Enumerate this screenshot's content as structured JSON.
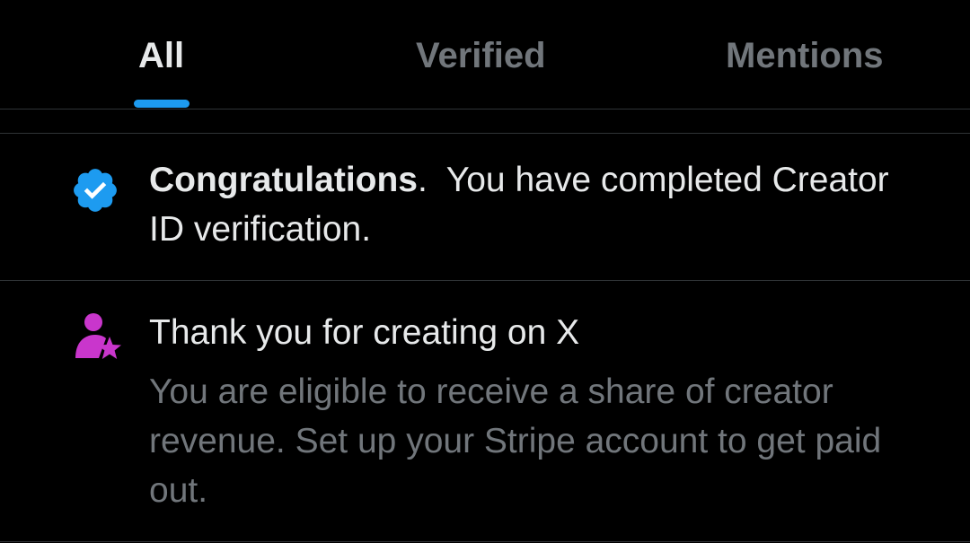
{
  "theme": {
    "background": "#000000",
    "text_primary": "#e7e9ea",
    "text_secondary": "#71767b",
    "divider": "#2f3336",
    "accent_blue": "#1d9bf0",
    "accent_purple": "#c936cc"
  },
  "tabs": [
    {
      "label": "All",
      "active": true
    },
    {
      "label": "Verified",
      "active": false
    },
    {
      "label": "Mentions",
      "active": false
    }
  ],
  "notifications": [
    {
      "icon": "verified-badge-icon",
      "title_bold": "Congratulations",
      "title_rest": ".  You have completed Creator ID verification."
    },
    {
      "icon": "creator-star-icon",
      "title": "Thank you for creating on X",
      "body": "You are eligible to receive a share of creator revenue. Set up your Stripe account to get paid out."
    }
  ]
}
